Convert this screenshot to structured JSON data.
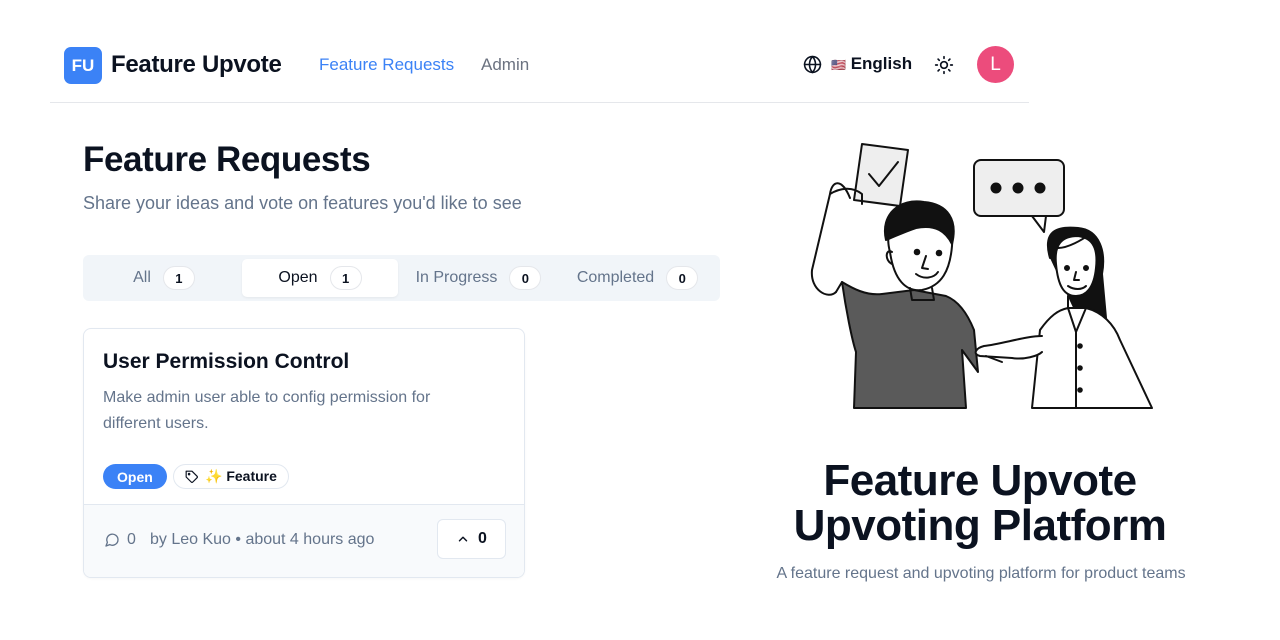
{
  "header": {
    "logo_text": "FU",
    "brand": "Feature Upvote",
    "nav": [
      {
        "label": "Feature Requests",
        "active": true
      },
      {
        "label": "Admin",
        "active": false
      }
    ],
    "language_flag": "🇺🇸",
    "language": "English",
    "avatar_initial": "L",
    "avatar_color": "#ec4c7c",
    "accent_color": "#3b82f6"
  },
  "page": {
    "title": "Feature Requests",
    "subtitle": "Share your ideas and vote on features you'd like to see"
  },
  "tabs": [
    {
      "label": "All",
      "count": "1",
      "active": false
    },
    {
      "label": "Open",
      "count": "1",
      "active": true
    },
    {
      "label": "In Progress",
      "count": "0",
      "active": false
    },
    {
      "label": "Completed",
      "count": "0",
      "active": false
    }
  ],
  "card": {
    "title": "User Permission Control",
    "description": "Make admin user able to config permission for different users.",
    "status": "Open",
    "tag": "✨ Feature",
    "comments": "0",
    "byline": "by Leo Kuo • about 4 hours ago",
    "votes": "0"
  },
  "hero": {
    "title_line1": "Feature Upvote",
    "title_line2": "Upvoting Platform",
    "subtitle": "A feature request and upvoting platform for product teams"
  }
}
